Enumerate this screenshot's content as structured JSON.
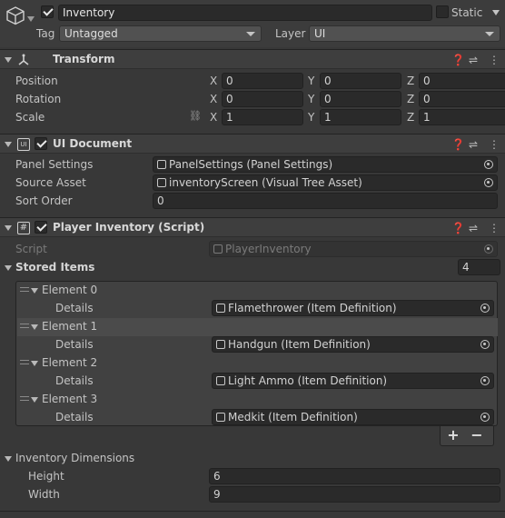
{
  "gameobject": {
    "name": "Inventory",
    "static_label": "Static",
    "tag_label": "Tag",
    "tag_value": "Untagged",
    "layer_label": "Layer",
    "layer_value": "UI"
  },
  "transform": {
    "title": "Transform",
    "rows": [
      {
        "label": "Position",
        "x": "0",
        "y": "0",
        "z": "0"
      },
      {
        "label": "Rotation",
        "x": "0",
        "y": "0",
        "z": "0"
      },
      {
        "label": "Scale",
        "x": "1",
        "y": "1",
        "z": "1"
      }
    ],
    "axis_labels": [
      "X",
      "Y",
      "Z"
    ]
  },
  "ui_document": {
    "title": "UI Document",
    "panel_settings_label": "Panel Settings",
    "panel_settings_value": "PanelSettings (Panel Settings)",
    "source_asset_label": "Source Asset",
    "source_asset_value": "inventoryScreen (Visual Tree Asset)",
    "sort_order_label": "Sort Order",
    "sort_order_value": "0"
  },
  "player_inventory": {
    "title": "Player Inventory (Script)",
    "script_label": "Script",
    "script_value": "PlayerInventory",
    "stored_items_label": "Stored Items",
    "stored_items_count": "4",
    "details_label": "Details",
    "elements": [
      {
        "label": "Element 0",
        "details": "Flamethrower (Item Definition)"
      },
      {
        "label": "Element 1",
        "details": "Handgun (Item Definition)"
      },
      {
        "label": "Element 2",
        "details": "Light Ammo (Item Definition)"
      },
      {
        "label": "Element 3",
        "details": "Medkit (Item Definition)"
      }
    ],
    "add_label": "+",
    "remove_label": "−",
    "dimensions_label": "Inventory Dimensions",
    "height_label": "Height",
    "height_value": "6",
    "width_label": "Width",
    "width_value": "9"
  },
  "colors": {
    "background": "#383838",
    "field": "#2a2a2a",
    "header": "#3e3e3e"
  }
}
